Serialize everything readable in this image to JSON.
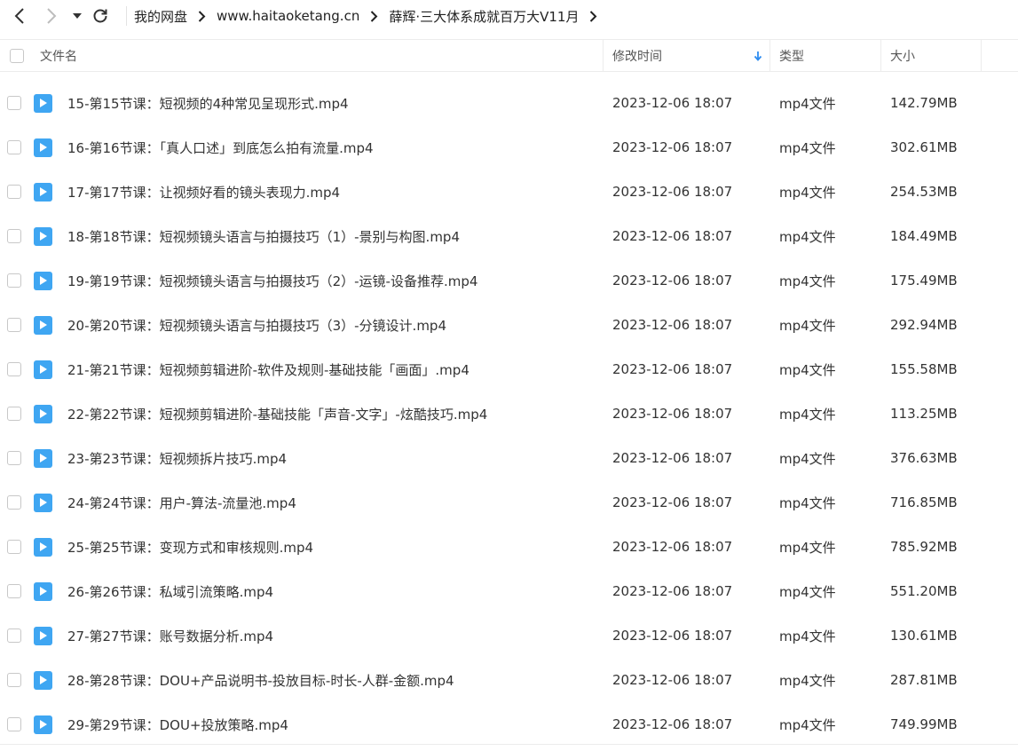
{
  "breadcrumb": {
    "items": [
      "我的网盘",
      "www.haitaoketang.cn",
      "薛辉·三大体系成就百万大V11月"
    ]
  },
  "columns": {
    "name": "文件名",
    "date": "修改时间",
    "type": "类型",
    "size": "大小"
  },
  "files": [
    {
      "name": "15-第15节课：短视频的4种常见呈现形式.mp4",
      "date": "2023-12-06 18:07",
      "type": "mp4文件",
      "size": "142.79MB"
    },
    {
      "name": "16-第16节课：「真人口述」到底怎么拍有流量.mp4",
      "date": "2023-12-06 18:07",
      "type": "mp4文件",
      "size": "302.61MB"
    },
    {
      "name": "17-第17节课：让视频好看的镜头表现力.mp4",
      "date": "2023-12-06 18:07",
      "type": "mp4文件",
      "size": "254.53MB"
    },
    {
      "name": "18-第18节课：短视频镜头语言与拍摄技巧（1）-景别与构图.mp4",
      "date": "2023-12-06 18:07",
      "type": "mp4文件",
      "size": "184.49MB"
    },
    {
      "name": "19-第19节课：短视频镜头语言与拍摄技巧（2）-运镜-设备推荐.mp4",
      "date": "2023-12-06 18:07",
      "type": "mp4文件",
      "size": "175.49MB"
    },
    {
      "name": "20-第20节课：短视频镜头语言与拍摄技巧（3）-分镜设计.mp4",
      "date": "2023-12-06 18:07",
      "type": "mp4文件",
      "size": "292.94MB"
    },
    {
      "name": "21-第21节课：短视频剪辑进阶-软件及规则-基础技能「画面」.mp4",
      "date": "2023-12-06 18:07",
      "type": "mp4文件",
      "size": "155.58MB"
    },
    {
      "name": "22-第22节课：短视频剪辑进阶-基础技能「声音-文字」-炫酷技巧.mp4",
      "date": "2023-12-06 18:07",
      "type": "mp4文件",
      "size": "113.25MB"
    },
    {
      "name": "23-第23节课：短视频拆片技巧.mp4",
      "date": "2023-12-06 18:07",
      "type": "mp4文件",
      "size": "376.63MB"
    },
    {
      "name": "24-第24节课：用户-算法-流量池.mp4",
      "date": "2023-12-06 18:07",
      "type": "mp4文件",
      "size": "716.85MB"
    },
    {
      "name": "25-第25节课：变现方式和审核规则.mp4",
      "date": "2023-12-06 18:07",
      "type": "mp4文件",
      "size": "785.92MB"
    },
    {
      "name": "26-第26节课：私域引流策略.mp4",
      "date": "2023-12-06 18:07",
      "type": "mp4文件",
      "size": "551.20MB"
    },
    {
      "name": "27-第27节课：账号数据分析.mp4",
      "date": "2023-12-06 18:07",
      "type": "mp4文件",
      "size": "130.61MB"
    },
    {
      "name": "28-第28节课：DOU+产品说明书-投放目标-时长-人群-金额.mp4",
      "date": "2023-12-06 18:07",
      "type": "mp4文件",
      "size": "287.81MB"
    },
    {
      "name": "29-第29节课：DOU+投放策略.mp4",
      "date": "2023-12-06 18:07",
      "type": "mp4文件",
      "size": "749.99MB"
    }
  ],
  "icons": {
    "back": "chevron-left-icon",
    "forward": "chevron-right-icon",
    "history": "caret-down-icon",
    "refresh": "refresh-icon",
    "file": "video-file-icon",
    "sort": "arrow-down-icon"
  },
  "colors": {
    "file_icon": "#3fa6f2",
    "sort_arrow": "#2d8cf0"
  }
}
